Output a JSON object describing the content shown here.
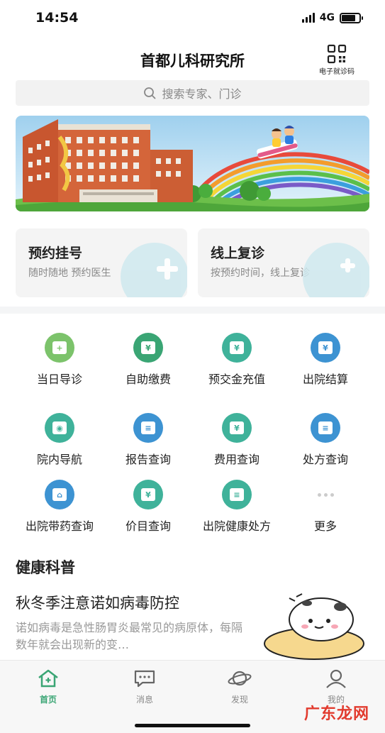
{
  "status_bar": {
    "time": "14:54",
    "network": "4G",
    "battery_level": 0.8
  },
  "header": {
    "title": "首都儿科研究所",
    "ecard_label": "电子就诊码",
    "ecard_icon": "qr-code-icon"
  },
  "search": {
    "placeholder": "搜索专家、门诊",
    "icon": "search-icon"
  },
  "banner": {
    "alt": "hospital-building-rainbow-banner"
  },
  "quick_cards": [
    {
      "title": "预约挂号",
      "subtitle": "随时随地 预约医生"
    },
    {
      "title": "线上复诊",
      "subtitle": "按预约时间，线上复诊"
    }
  ],
  "services": [
    {
      "label": "当日导诊",
      "icon": "triage-icon",
      "color": "#7cc36b"
    },
    {
      "label": "自助缴费",
      "icon": "payment-icon",
      "color": "#3aa574"
    },
    {
      "label": "预交金充值",
      "icon": "deposit-icon",
      "color": "#3fb29a"
    },
    {
      "label": "出院结算",
      "icon": "settlement-icon",
      "color": "#3d93d2"
    },
    {
      "label": "院内导航",
      "icon": "navigation-icon",
      "color": "#3fb29a"
    },
    {
      "label": "报告查询",
      "icon": "report-icon",
      "color": "#3d93d2"
    },
    {
      "label": "费用查询",
      "icon": "expense-icon",
      "color": "#3fb29a"
    },
    {
      "label": "处方查询",
      "icon": "prescription-icon",
      "color": "#3d93d2"
    },
    {
      "label": "出院带药查询",
      "icon": "discharge-medicine-icon",
      "color": "#3d93d2"
    },
    {
      "label": "价目查询",
      "icon": "price-icon",
      "color": "#3fb29a"
    },
    {
      "label": "出院健康处方",
      "icon": "health-prescription-icon",
      "color": "#3fb29a"
    },
    {
      "label": "更多",
      "icon": "more-icon",
      "color": "#cccccc"
    }
  ],
  "health_section": {
    "title": "健康科普",
    "article": {
      "title": "秋冬季注意诺如病毒防控",
      "summary": "诺如病毒是急性肠胃炎最常见的病原体，每隔数年就会出现新的变…"
    }
  },
  "tabbar": {
    "accent_color": "#3aa574",
    "items": [
      {
        "label": "首页",
        "icon": "home-icon",
        "active": true
      },
      {
        "label": "消息",
        "icon": "message-icon",
        "active": false
      },
      {
        "label": "发现",
        "icon": "planet-icon",
        "active": false
      },
      {
        "label": "我的",
        "icon": "user-icon",
        "active": false
      }
    ]
  },
  "watermark": "广东龙网"
}
